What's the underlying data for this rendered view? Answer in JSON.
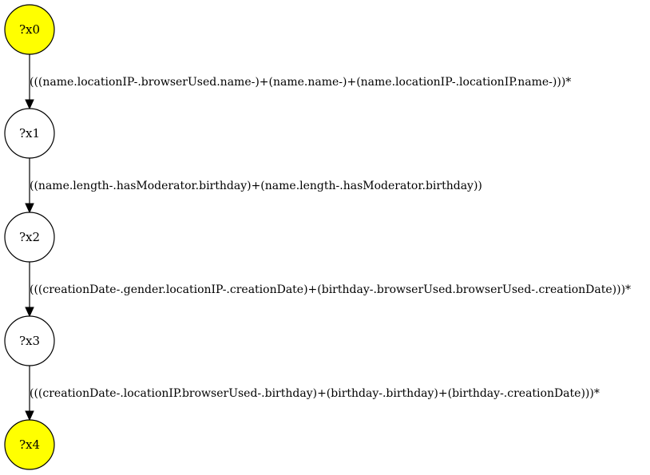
{
  "colors": {
    "highlight": "#ffff00",
    "plain": "#ffffff",
    "stroke": "#000000"
  },
  "nodes": [
    {
      "id": "x0",
      "label": "?x0",
      "highlighted": true
    },
    {
      "id": "x1",
      "label": "?x1",
      "highlighted": false
    },
    {
      "id": "x2",
      "label": "?x2",
      "highlighted": false
    },
    {
      "id": "x3",
      "label": "?x3",
      "highlighted": false
    },
    {
      "id": "x4",
      "label": "?x4",
      "highlighted": true
    }
  ],
  "edges": [
    {
      "from": "x0",
      "to": "x1",
      "label": "(((name.locationIP-.browserUsed.name-)+(name.name-)+(name.locationIP-.locationIP.name-)))*"
    },
    {
      "from": "x1",
      "to": "x2",
      "label": "((name.length-.hasModerator.birthday)+(name.length-.hasModerator.birthday))"
    },
    {
      "from": "x2",
      "to": "x3",
      "label": "(((creationDate-.gender.locationIP-.creationDate)+(birthday-.browserUsed.browserUsed-.creationDate)))*"
    },
    {
      "from": "x3",
      "to": "x4",
      "label": "(((creationDate-.locationIP.browserUsed-.birthday)+(birthday-.birthday)+(birthday-.creationDate)))*"
    }
  ]
}
